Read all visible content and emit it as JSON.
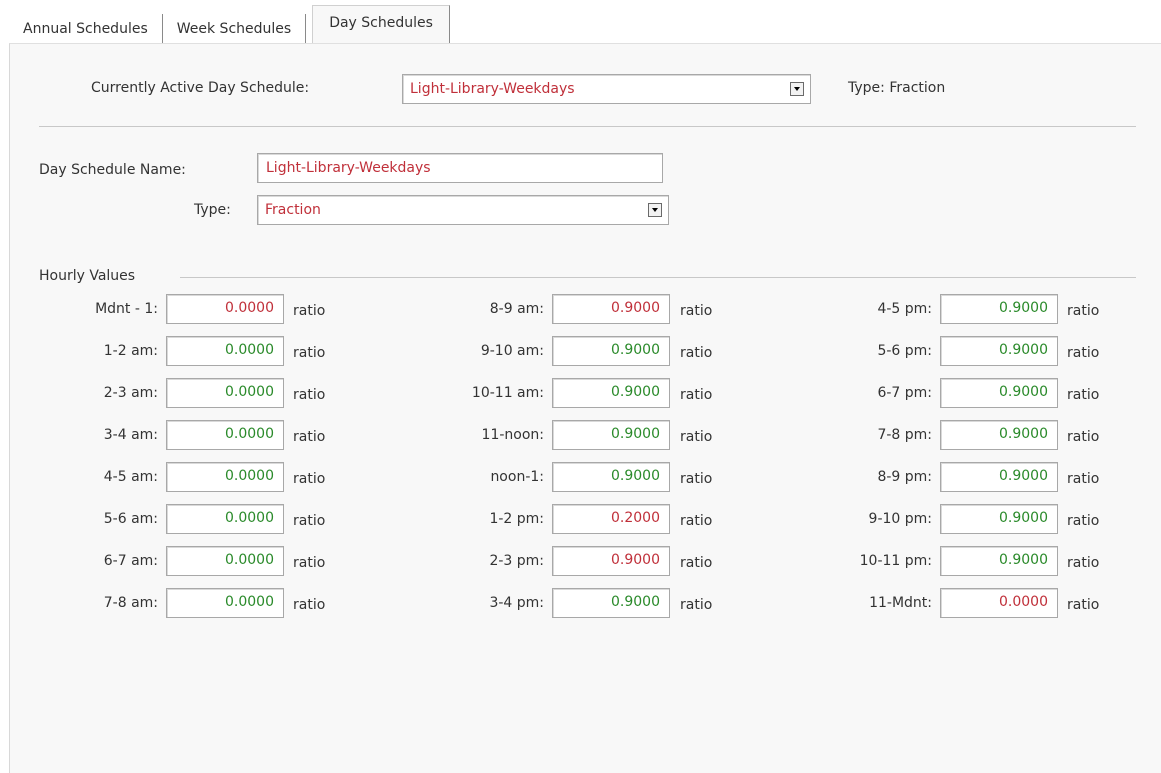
{
  "tabs": [
    {
      "label": "Annual Schedules",
      "active": false
    },
    {
      "label": "Week Schedules",
      "active": false
    },
    {
      "label": "Day Schedules",
      "active": true
    }
  ],
  "active_schedule": {
    "label": "Currently Active Day Schedule:",
    "value": "Light-Library-Weekdays",
    "type_text": "Type: Fraction"
  },
  "name_field": {
    "label": "Day Schedule Name:",
    "value": "Light-Library-Weekdays"
  },
  "type_field": {
    "label": "Type:",
    "value": "Fraction"
  },
  "hourly": {
    "title": "Hourly Values",
    "unit": "ratio",
    "columns": [
      [
        {
          "label": "Mdnt - 1:",
          "value": "0.0000",
          "status": "red"
        },
        {
          "label": "1-2 am:",
          "value": "0.0000",
          "status": "green"
        },
        {
          "label": "2-3 am:",
          "value": "0.0000",
          "status": "green"
        },
        {
          "label": "3-4 am:",
          "value": "0.0000",
          "status": "green"
        },
        {
          "label": "4-5 am:",
          "value": "0.0000",
          "status": "green"
        },
        {
          "label": "5-6 am:",
          "value": "0.0000",
          "status": "green"
        },
        {
          "label": "6-7 am:",
          "value": "0.0000",
          "status": "green"
        },
        {
          "label": "7-8 am:",
          "value": "0.0000",
          "status": "green"
        }
      ],
      [
        {
          "label": "8-9 am:",
          "value": "0.9000",
          "status": "red"
        },
        {
          "label": "9-10 am:",
          "value": "0.9000",
          "status": "green"
        },
        {
          "label": "10-11 am:",
          "value": "0.9000",
          "status": "green"
        },
        {
          "label": "11-noon:",
          "value": "0.9000",
          "status": "green"
        },
        {
          "label": "noon-1:",
          "value": "0.9000",
          "status": "green"
        },
        {
          "label": "1-2 pm:",
          "value": "0.2000",
          "status": "red"
        },
        {
          "label": "2-3 pm:",
          "value": "0.9000",
          "status": "red"
        },
        {
          "label": "3-4 pm:",
          "value": "0.9000",
          "status": "green"
        }
      ],
      [
        {
          "label": "4-5 pm:",
          "value": "0.9000",
          "status": "green"
        },
        {
          "label": "5-6 pm:",
          "value": "0.9000",
          "status": "green"
        },
        {
          "label": "6-7 pm:",
          "value": "0.9000",
          "status": "green"
        },
        {
          "label": "7-8 pm:",
          "value": "0.9000",
          "status": "green"
        },
        {
          "label": "8-9 pm:",
          "value": "0.9000",
          "status": "green"
        },
        {
          "label": "9-10 pm:",
          "value": "0.9000",
          "status": "green"
        },
        {
          "label": "10-11 pm:",
          "value": "0.9000",
          "status": "green"
        },
        {
          "label": "11-Mdnt:",
          "value": "0.0000",
          "status": "red"
        }
      ]
    ]
  },
  "colors": {
    "value_green": "#2a8a2a",
    "value_red": "#c0303a"
  }
}
